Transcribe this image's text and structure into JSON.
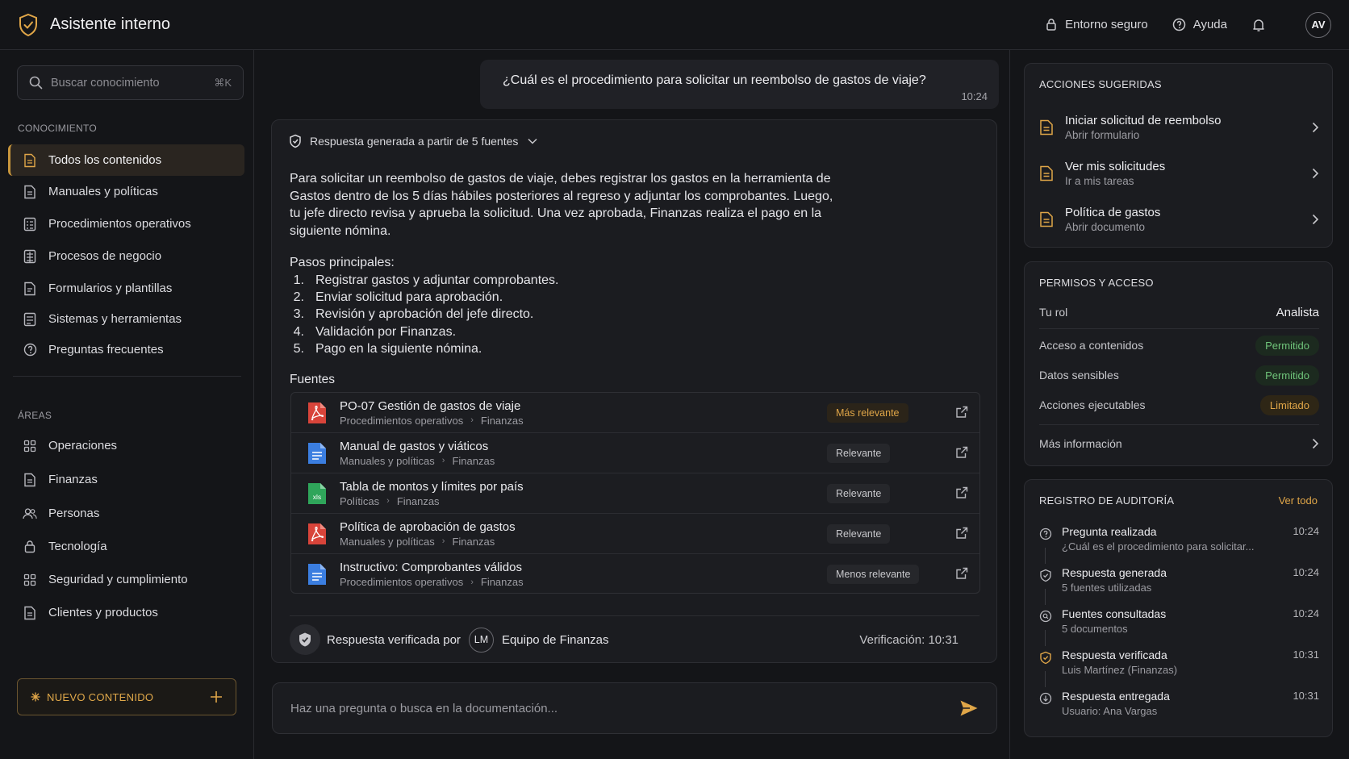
{
  "app": {
    "title": "Asistente interno"
  },
  "topbar": {
    "secure": "Entorno seguro",
    "help": "Ayuda",
    "avatar": "AV"
  },
  "sidebar": {
    "search_placeholder": "Buscar conocimiento",
    "search_shortcut": "⌘K",
    "knowledge_label": "CONOCIMIENTO",
    "knowledge_items": [
      {
        "label": "Todos los contenidos"
      },
      {
        "label": "Manuales y políticas"
      },
      {
        "label": "Procedimientos operativos"
      },
      {
        "label": "Procesos de negocio"
      },
      {
        "label": "Formularios y plantillas"
      },
      {
        "label": "Sistemas y herramientas"
      },
      {
        "label": "Preguntas frecuentes"
      }
    ],
    "areas_label": "ÁREAS",
    "area_items": [
      {
        "label": "Operaciones"
      },
      {
        "label": "Finanzas"
      },
      {
        "label": "Personas"
      },
      {
        "label": "Tecnología"
      },
      {
        "label": "Seguridad y cumplimiento"
      },
      {
        "label": "Clientes y productos"
      }
    ],
    "new_button": "NUEVO CONTENIDO"
  },
  "chat": {
    "question": "¿Cuál es el procedimiento para solicitar un reembolso de gastos de viaje?",
    "question_time": "10:24",
    "answer_header": "Respuesta generada a partir de 5 fuentes",
    "answer_lines": [
      "Para solicitar un reembolso de gastos de viaje, debes registrar los gastos en la herramienta de",
      "Gastos dentro de los 5 días hábiles posteriores al regreso y adjuntar los comprobantes. Luego,",
      "tu jefe directo revisa y aprueba la solicitud. Una vez aprobada, Finanzas realiza el pago en la",
      "siguiente nómina."
    ],
    "steps_title": "Pasos principales:",
    "steps": [
      {
        "num": "1.",
        "text": "Registrar gastos y adjuntar comprobantes."
      },
      {
        "num": "2.",
        "text": "Enviar solicitud para aprobación."
      },
      {
        "num": "3.",
        "text": "Revisión y aprobación del jefe directo."
      },
      {
        "num": "4.",
        "text": "Validación por Finanzas."
      },
      {
        "num": "5.",
        "text": "Pago en la siguiente nómina."
      }
    ],
    "sources_title": "Fuentes",
    "sources": [
      {
        "title": "PO-07 Gestión de gastos de viaje",
        "path1": "Procedimientos operativos",
        "path2": "Finanzas",
        "badge": "Más relevante",
        "type": "pdf"
      },
      {
        "title": "Manual de gastos y viáticos",
        "path1": "Manuales y políticas",
        "path2": "Finanzas",
        "badge": "Relevante",
        "type": "doc"
      },
      {
        "title": "Tabla de montos y límites por país",
        "path1": "Políticas",
        "path2": "Finanzas",
        "badge": "Relevante",
        "type": "xls"
      },
      {
        "title": "Política de aprobación de gastos",
        "path1": "Manuales y políticas",
        "path2": "Finanzas",
        "badge": "Relevante",
        "type": "pdf"
      },
      {
        "title": "Instructivo: Comprobantes válidos",
        "path1": "Procedimientos operativos",
        "path2": "Finanzas",
        "badge": "Menos relevante",
        "type": "doc"
      }
    ],
    "verified_by": "Respuesta verificada por",
    "verifier_initials": "LM",
    "verifier_team": "Equipo de Finanzas",
    "verification_time": "Verificación: 10:31",
    "composer_placeholder": "Haz una pregunta o busca en la documentación..."
  },
  "right": {
    "suggested_title": "ACCIONES SUGERIDAS",
    "actions": [
      {
        "title": "Iniciar solicitud de reembolso",
        "subtitle": "Abrir formulario"
      },
      {
        "title": "Ver mis solicitudes",
        "subtitle": "Ir a mis tareas"
      },
      {
        "title": "Política de gastos",
        "subtitle": "Abrir documento"
      }
    ],
    "permissions_title": "PERMISOS Y ACCESO",
    "role_label": "Tu rol",
    "role_value": "Analista",
    "permissions": [
      {
        "label": "Acceso a contenidos",
        "value": "Permitido",
        "status": "ok"
      },
      {
        "label": "Datos sensibles",
        "value": "Permitido",
        "status": "ok"
      },
      {
        "label": "Acciones ejecutables",
        "value": "Limitado",
        "status": "limited"
      }
    ],
    "more_info": "Más información",
    "audit_title": "REGISTRO DE AUDITORÍA",
    "audit_view_all": "Ver todo",
    "audit": [
      {
        "title": "Pregunta realizada",
        "detail": "¿Cuál es el procedimiento para solicitar...",
        "time": "10:24"
      },
      {
        "title": "Respuesta generada",
        "detail": "5 fuentes utilizadas",
        "time": "10:24"
      },
      {
        "title": "Fuentes consultadas",
        "detail": "5 documentos",
        "time": "10:24"
      },
      {
        "title": "Respuesta verificada",
        "detail": "Luis Martínez (Finanzas)",
        "time": "10:31"
      },
      {
        "title": "Respuesta entregada",
        "detail": "Usuario: Ana Vargas",
        "time": "10:31"
      }
    ]
  },
  "colors": {
    "accent": "#e0a648",
    "background": "#141518",
    "card": "#1b1c20",
    "ok": "#6fc47a",
    "pdf": "#d8443a",
    "doc": "#3b7ee0",
    "xls": "#2fa55a"
  }
}
